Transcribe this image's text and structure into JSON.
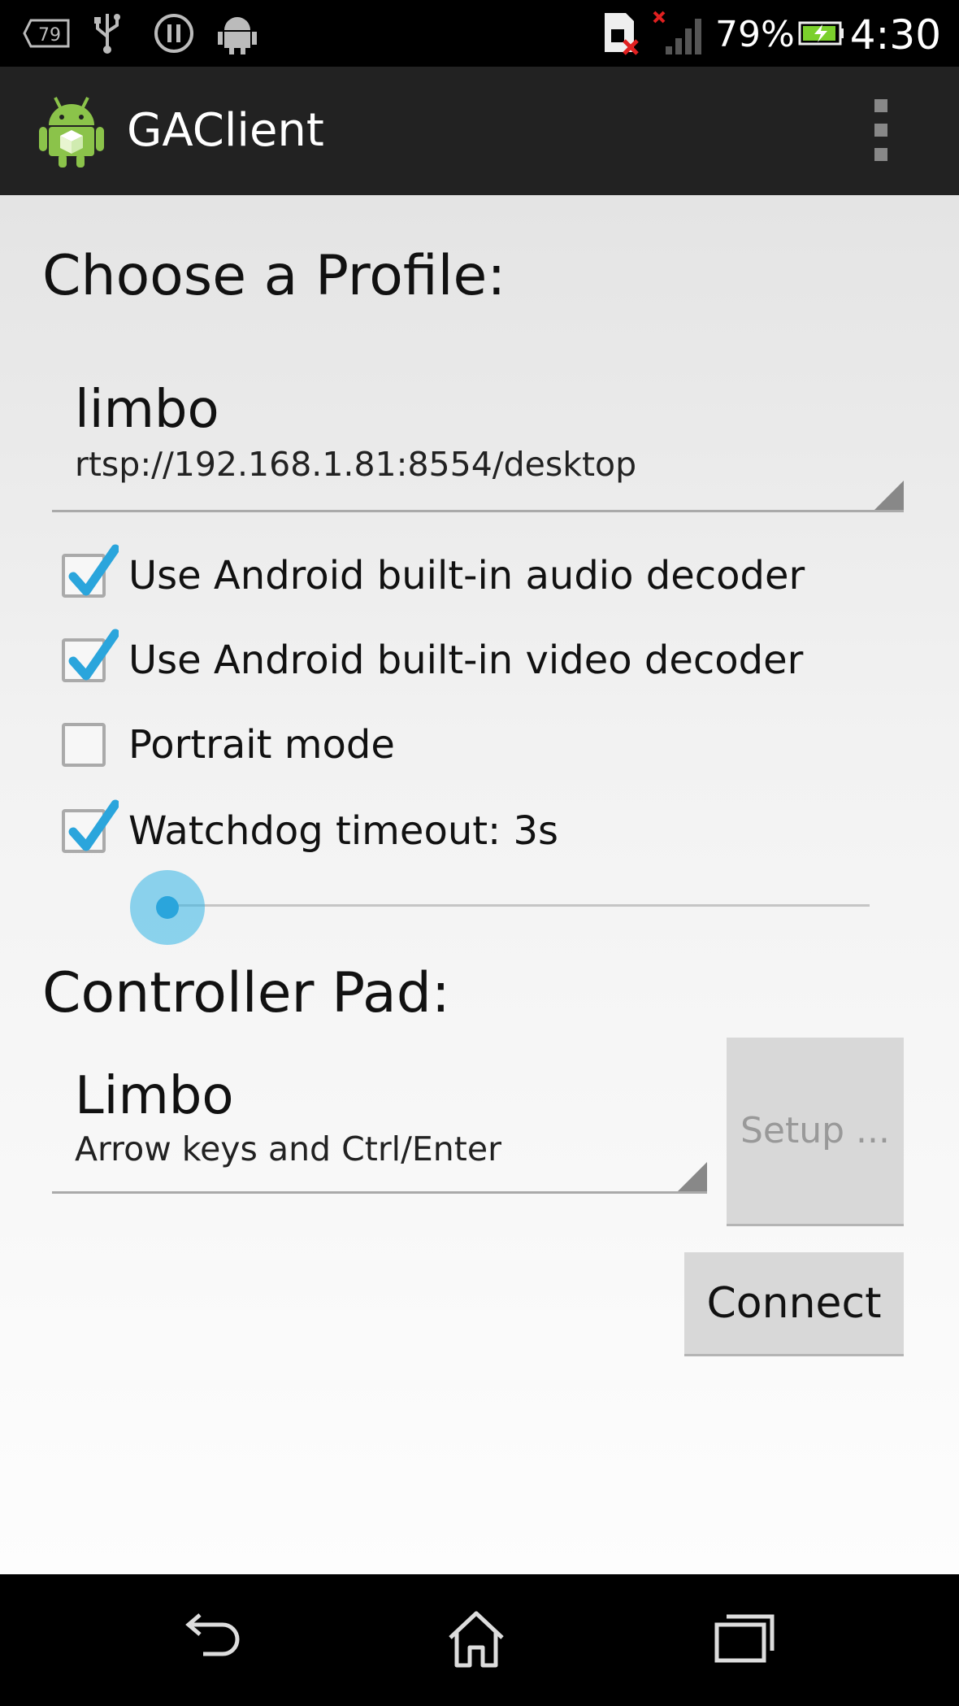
{
  "status_bar": {
    "notification_badge": "79",
    "battery_percent": "79%",
    "time": "4:30"
  },
  "action_bar": {
    "title": "GAClient"
  },
  "profile": {
    "heading": "Choose a Profile:",
    "selected_name": "limbo",
    "selected_url": "rtsp://192.168.1.81:8554/desktop"
  },
  "options": [
    {
      "label": "Use Android built-in audio decoder",
      "checked": true
    },
    {
      "label": "Use Android built-in video decoder",
      "checked": true
    },
    {
      "label": "Portrait mode",
      "checked": false
    },
    {
      "label": "Watchdog timeout: 3s",
      "checked": true
    }
  ],
  "watchdog_slider": {
    "value_fraction": 0.0
  },
  "controller": {
    "heading": "Controller Pad:",
    "selected_name": "Limbo",
    "selected_desc": "Arrow keys and Ctrl/Enter",
    "setup_label": "Setup ...",
    "connect_label": "Connect"
  },
  "colors": {
    "accent": "#33b5e5",
    "action_bar": "#222222"
  },
  "nav_bar": {
    "icons": [
      "back-icon",
      "home-icon",
      "recent-apps-icon"
    ]
  }
}
